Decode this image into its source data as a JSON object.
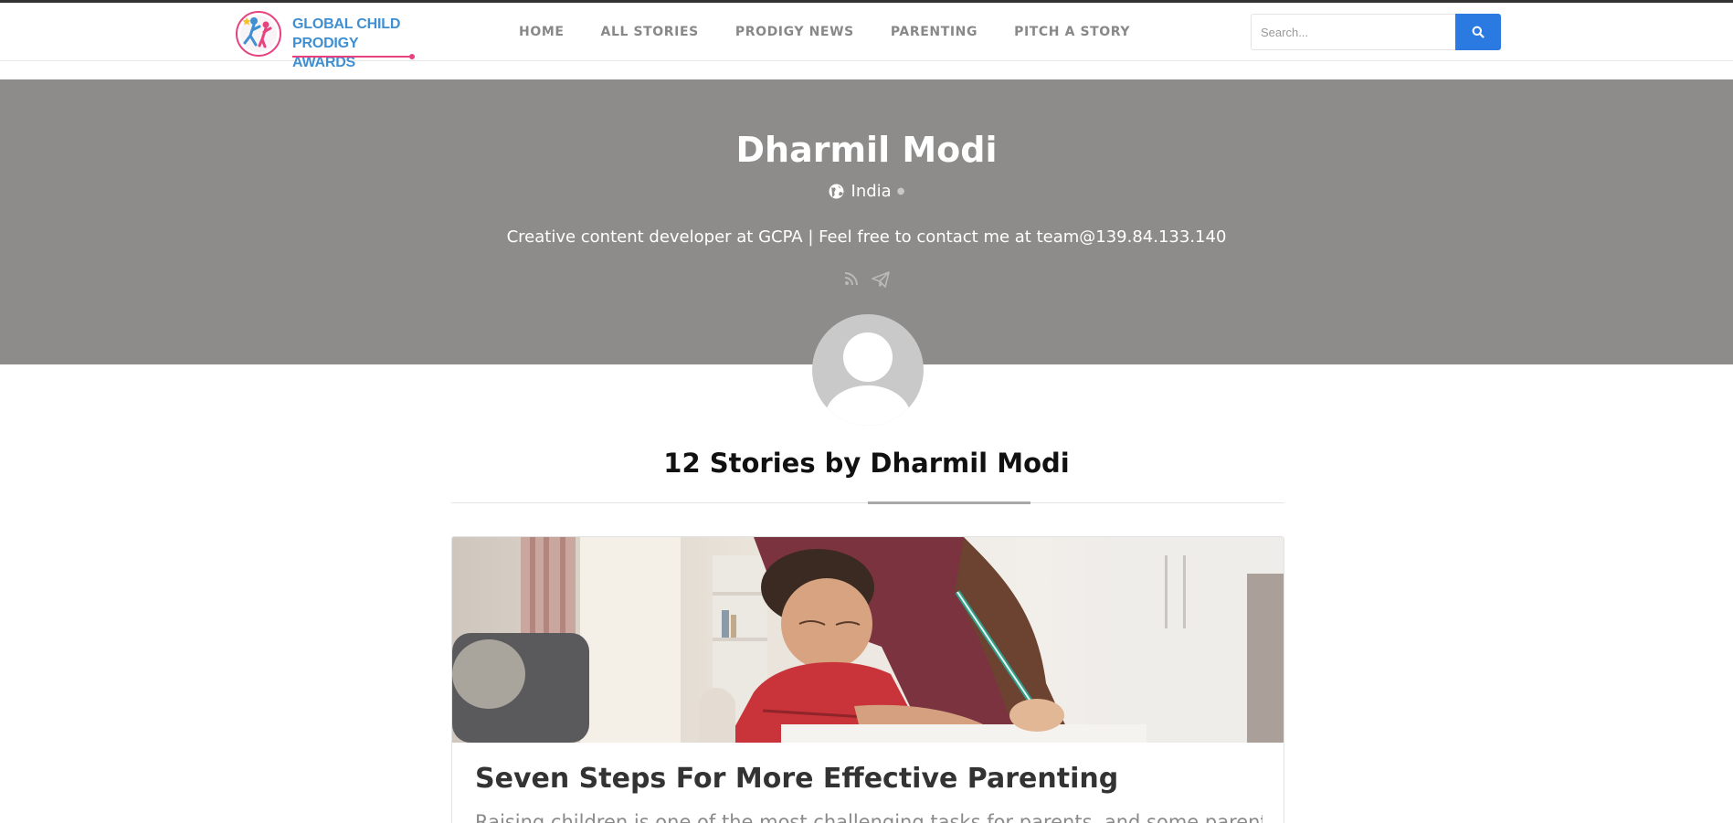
{
  "brand": {
    "line1": "GLOBAL CHILD",
    "line2": "PRODIGY AWARDS"
  },
  "nav": {
    "items": [
      "HOME",
      "ALL STORIES",
      "PRODIGY NEWS",
      "PARENTING",
      "PITCH A STORY"
    ]
  },
  "search": {
    "placeholder": "Search...",
    "button_icon": "search-icon"
  },
  "profile": {
    "name": "Dharmil Modi",
    "location": "India",
    "location_icon": "globe-icon",
    "bio": "Creative content developer at GCPA | Feel free to contact me at team@139.84.133.140",
    "social_icons": [
      "rss-icon",
      "paper-plane-icon"
    ]
  },
  "stories": {
    "heading": "12 Stories by Dharmil Modi",
    "items": [
      {
        "title": "Seven Steps For More Effective Parenting",
        "excerpt": "Raising children is one of the most challenging tasks for parents, and some parents"
      }
    ]
  },
  "colors": {
    "hero_bg": "#8d8c8b",
    "accent_blue": "#2a7ae2",
    "brand_blue": "#3f8fd2",
    "brand_pink": "#e8417f"
  }
}
